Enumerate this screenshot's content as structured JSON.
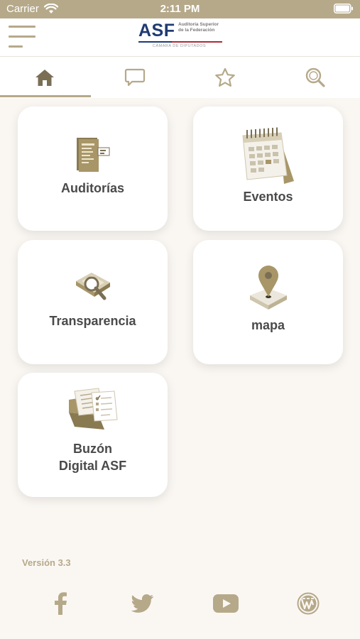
{
  "status_bar": {
    "carrier": "Carrier",
    "time": "2:11 PM",
    "icons": [
      "wifi-icon",
      "battery-icon"
    ]
  },
  "header": {
    "logo": {
      "text": "ASF",
      "subtitle": "Auditoría Superior de la Federación",
      "tagline": "CÁMARA DE DIPUTADOS"
    },
    "menu_icon": "hamburger-icon"
  },
  "tabs": [
    {
      "icon": "home-icon",
      "active": true
    },
    {
      "icon": "chat-icon",
      "active": false
    },
    {
      "icon": "star-icon",
      "active": false
    },
    {
      "icon": "search-icon",
      "active": false
    }
  ],
  "menu": [
    {
      "label": "Auditorías",
      "icon": "audit-document-icon"
    },
    {
      "label": "Eventos",
      "icon": "calendar-icon"
    },
    {
      "label": "Transparencia",
      "icon": "magnifier-map-icon"
    },
    {
      "label": "mapa",
      "icon": "map-pin-icon"
    },
    {
      "label": "Buzón\nDigital ASF",
      "icon": "mailbox-documents-icon"
    }
  ],
  "footer": {
    "version": "Versión 3.3",
    "social": [
      "facebook-icon",
      "twitter-icon",
      "youtube-icon",
      "wordpress-icon"
    ]
  },
  "colors": {
    "accent": "#b6a98a",
    "background": "#faf7f3",
    "text": "#4a4a4a",
    "brand_blue": "#1f3b73",
    "brand_red": "#b02a37"
  }
}
